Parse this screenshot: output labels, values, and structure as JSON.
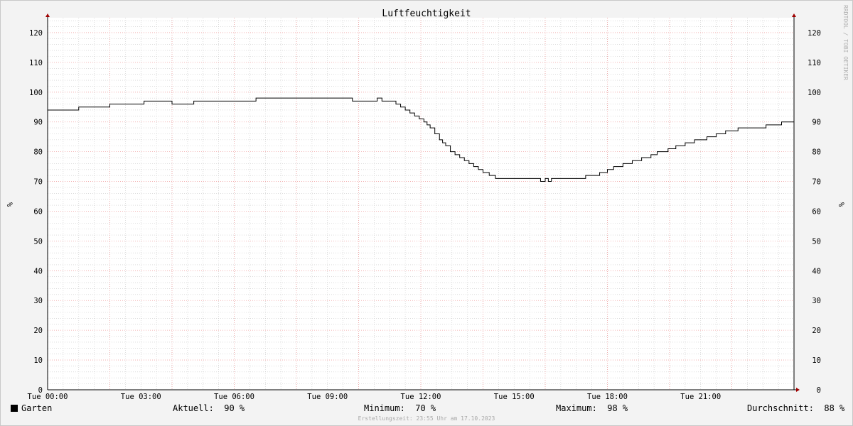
{
  "chart_data": {
    "type": "line",
    "title": "Luftfeuchtigkeit",
    "ylabel": "%",
    "ylim": [
      0,
      125
    ],
    "y_major_ticks": [
      0,
      10,
      20,
      30,
      40,
      50,
      60,
      70,
      80,
      90,
      100,
      110,
      120
    ],
    "x_range_hours": [
      0,
      24
    ],
    "x_tick_labels": [
      "Tue 00:00",
      "Tue 03:00",
      "Tue 06:00",
      "Tue 09:00",
      "Tue 12:00",
      "Tue 15:00",
      "Tue 18:00",
      "Tue 21:00"
    ],
    "x_tick_hours": [
      0,
      3,
      6,
      9,
      12,
      15,
      18,
      21
    ],
    "grid": true,
    "legend_position": "bottom-left",
    "series": [
      {
        "name": "Garten",
        "color": "#000000",
        "x": [
          0,
          1,
          2,
          3.1,
          4,
          4.7,
          6.7,
          9.8,
          10.6,
          10.75,
          11.2,
          11.35,
          11.5,
          11.65,
          11.8,
          11.95,
          12.1,
          12.2,
          12.3,
          12.45,
          12.6,
          12.7,
          12.8,
          12.95,
          13.1,
          13.25,
          13.4,
          13.55,
          13.7,
          13.85,
          14,
          14.2,
          14.4,
          15.85,
          16,
          16.1,
          16.2,
          16.4,
          17.3,
          17.75,
          18,
          18.2,
          18.5,
          18.8,
          19.1,
          19.4,
          19.6,
          19.95,
          20.2,
          20.5,
          20.8,
          21.2,
          21.5,
          21.8,
          22.2,
          23.1,
          23.6
        ],
        "values": [
          94,
          95,
          96,
          97,
          96,
          97,
          98,
          97,
          98,
          97,
          96,
          95,
          94,
          93,
          92,
          91,
          90,
          89,
          88,
          86,
          84,
          83,
          82,
          80,
          79,
          78,
          77,
          76,
          75,
          74,
          73,
          72,
          71,
          70,
          71,
          70,
          71,
          71,
          72,
          73,
          74,
          75,
          76,
          77,
          78,
          79,
          80,
          81,
          82,
          83,
          84,
          85,
          86,
          87,
          88,
          89,
          90
        ]
      }
    ]
  },
  "legend": {
    "series_name": "Garten",
    "aktuell": "Aktuell:  90 %",
    "minimum": "Minimum:  70 %",
    "maximum": "Maximum:  98 %",
    "durchschnitt": "Durchschnitt:  88 %"
  },
  "watermark": "RRDTOOL / TOBI OETIKER",
  "footer": "Erstellungszeit: 23:55 Uhr am 17.10.2023",
  "colors": {
    "major_grid": "#f0a0a0",
    "minor_grid": "#c8c8c8",
    "line": "#000000",
    "arrow": "#a00000"
  }
}
